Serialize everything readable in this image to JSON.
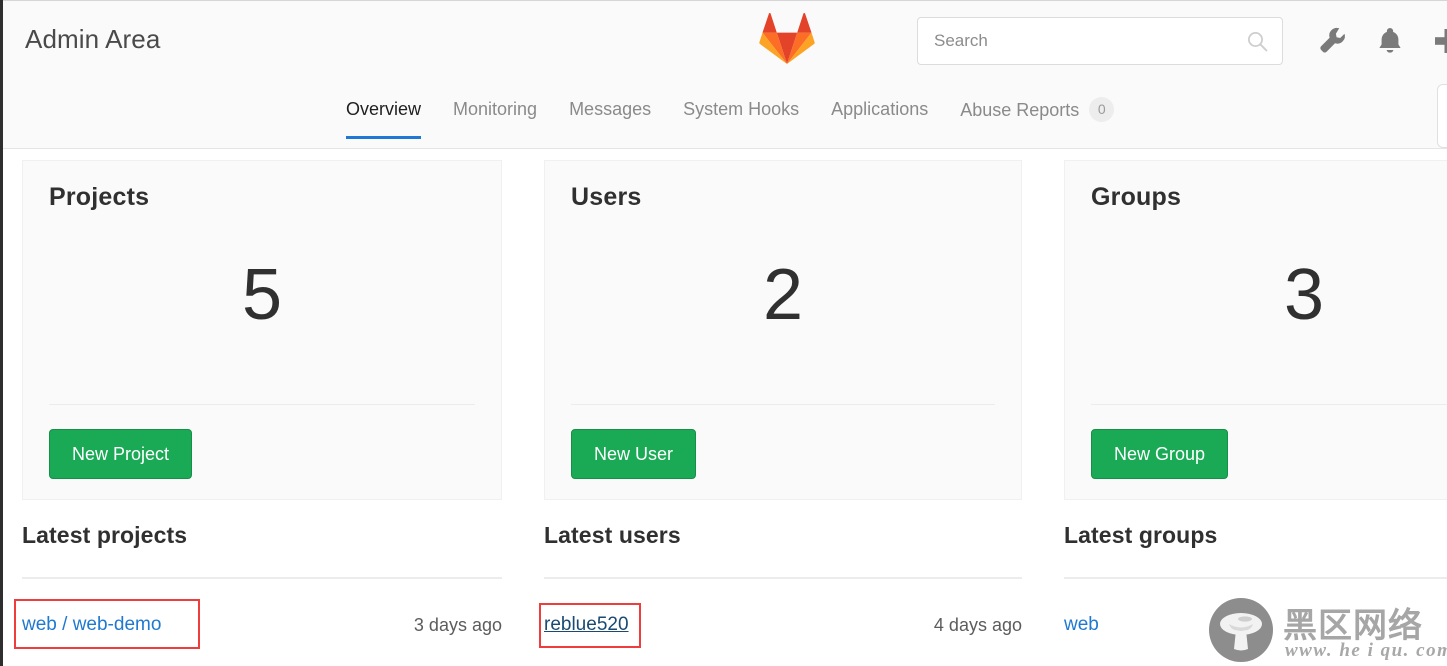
{
  "header": {
    "title": "Admin Area",
    "logo_icon": "gitlab-tanuki-logo",
    "search": {
      "placeholder": "Search",
      "value": "",
      "icon": "search-icon"
    },
    "icons": [
      {
        "name": "wrench-icon",
        "label": "Admin settings"
      },
      {
        "name": "bell-icon",
        "label": "Notifications"
      },
      {
        "name": "plus-icon",
        "label": "New"
      }
    ]
  },
  "tabs": [
    {
      "label": "Overview",
      "active": true,
      "badge": null
    },
    {
      "label": "Monitoring",
      "active": false,
      "badge": null
    },
    {
      "label": "Messages",
      "active": false,
      "badge": null
    },
    {
      "label": "System Hooks",
      "active": false,
      "badge": null
    },
    {
      "label": "Applications",
      "active": false,
      "badge": null
    },
    {
      "label": "Abuse Reports",
      "active": false,
      "badge": "0"
    }
  ],
  "cards": [
    {
      "title": "Projects",
      "count": "5",
      "button": "New Project"
    },
    {
      "title": "Users",
      "count": "2",
      "button": "New User"
    },
    {
      "title": "Groups",
      "count": "3",
      "button": "New Group"
    }
  ],
  "latest": [
    {
      "title": "Latest projects",
      "item_label": "web / web-demo",
      "item_time": "3 days ago",
      "hovered": false
    },
    {
      "title": "Latest users",
      "item_label": "reblue520",
      "item_time": "4 days ago",
      "hovered": true
    },
    {
      "title": "Latest groups",
      "item_label": "web",
      "item_time": "",
      "hovered": false
    }
  ],
  "watermark": {
    "icon": "mushroom-logo-icon",
    "brand": "黑区网络",
    "url": "www. he i qu. com"
  },
  "colors": {
    "accent_blue": "#1f78d1",
    "green_button": "#1aaa55",
    "link_blue": "#1f78d1",
    "link_hover": "#1a4971",
    "annotation_red": "#ef3d3d",
    "header_bg": "#fafafa",
    "card_bg": "#fafafa"
  }
}
